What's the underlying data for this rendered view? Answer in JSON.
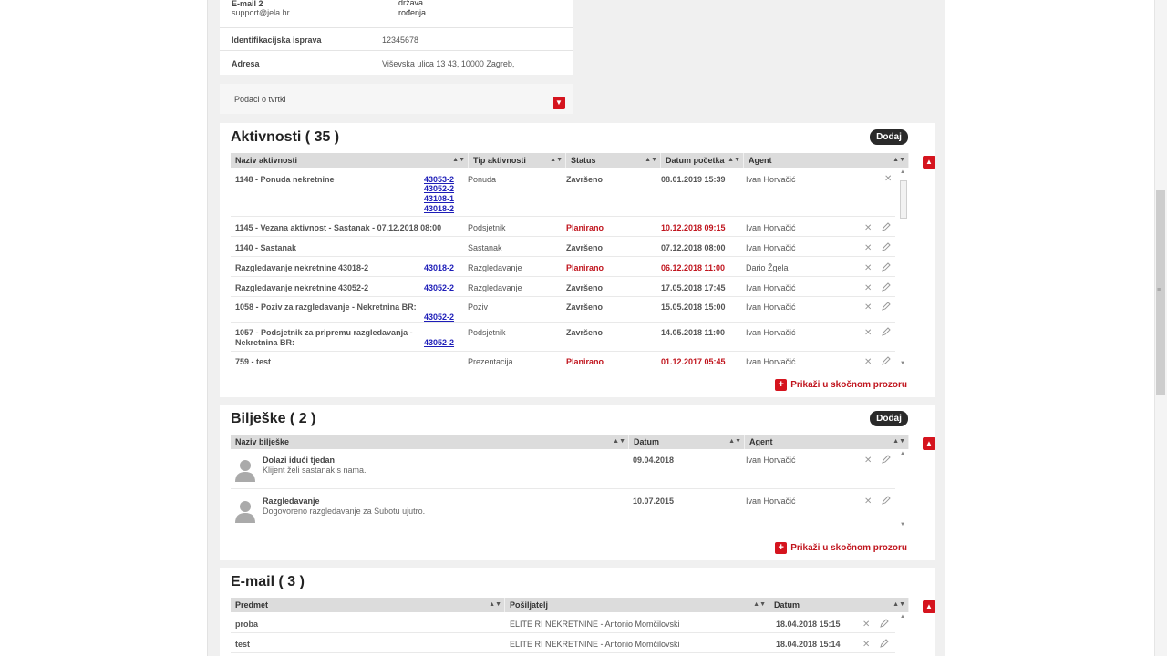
{
  "contact": {
    "email_label": "E-mail 2",
    "email_value": "support@jela.hr",
    "country_label_1": "država",
    "country_label_2": "rođenja",
    "id_label": "Identifikacijska isprava",
    "id_value": "12345678",
    "address_label": "Adresa",
    "address_value": "Viševska ulica 13 43, 10000 Zagreb,",
    "company_label": "Podaci o tvrtki"
  },
  "aktivnosti": {
    "title": "Aktivnosti ( 35 )",
    "add_label": "Dodaj",
    "columns": [
      "Naziv aktivnosti",
      "Tip aktivnosti",
      "Status",
      "Datum početka",
      "Agent"
    ],
    "rows": [
      {
        "name": "1148 - Ponuda nekretnine",
        "name2": "",
        "links": [
          "43053-2",
          "43052-2",
          "43108-1",
          "43018-2"
        ],
        "type": "Ponuda",
        "status": "Završeno",
        "date": "08.01.2019 15:39",
        "agent": "Ivan Horvačić",
        "red": false
      },
      {
        "name": "1145 - Vezana aktivnost - Sastanak - 07.12.2018 08:00",
        "name2": "",
        "links": [],
        "type": "Podsjetnik",
        "status": "Planirano",
        "date": "10.12.2018 09:15",
        "agent": "Ivan Horvačić",
        "red": true
      },
      {
        "name": "1140 - Sastanak",
        "name2": "",
        "links": [],
        "type": "Sastanak",
        "status": "Završeno",
        "date": "07.12.2018 08:00",
        "agent": "Ivan Horvačić",
        "red": false
      },
      {
        "name": "Razgledavanje nekretnine 43018-2",
        "name2": "",
        "links": [
          "43018-2"
        ],
        "type": "Razgledavanje",
        "status": "Planirano",
        "date": "06.12.2018 11:00",
        "agent": "Dario Žgela",
        "red": true
      },
      {
        "name": "Razgledavanje nekretnine 43052-2",
        "name2": "",
        "links": [
          "43052-2"
        ],
        "type": "Razgledavanje",
        "status": "Završeno",
        "date": "17.05.2018 17:45",
        "agent": "Ivan Horvačić",
        "red": false
      },
      {
        "name": "1058 - Poziv za razgledavanje - Nekretnina BR:",
        "name2": "",
        "links": [
          "43052-2"
        ],
        "type": "Poziv",
        "status": "Završeno",
        "date": "15.05.2018 15:00",
        "agent": "Ivan Horvačić",
        "red": false
      },
      {
        "name": "1057 - Podsjetnik za pripremu razgledavanja -",
        "name2": "Nekretnina BR:",
        "links": [
          "43052-2"
        ],
        "type": "Podsjetnik",
        "status": "Završeno",
        "date": "14.05.2018 11:00",
        "agent": "Ivan Horvačić",
        "red": false
      },
      {
        "name": "759 - test",
        "name2": "",
        "links": [],
        "type": "Prezentacija",
        "status": "Planirano",
        "date": "01.12.2017 05:45",
        "agent": "Ivan Horvačić",
        "red": true
      }
    ],
    "popup_label": "Prikaži u skočnom prozoru"
  },
  "biljeske": {
    "title": "Bilješke ( 2 )",
    "add_label": "Dodaj",
    "columns": [
      "Naziv bilješke",
      "Datum",
      "Agent"
    ],
    "rows": [
      {
        "title": "Dolazi idući tjedan",
        "text": "Klijent želi sastanak s nama.",
        "date": "09.04.2018",
        "agent": "Ivan Horvačić"
      },
      {
        "title": "Razgledavanje",
        "text": "Dogovoreno razgledavanje za Subotu ujutro.",
        "date": "10.07.2015",
        "agent": "Ivan Horvačić"
      }
    ],
    "popup_label": "Prikaži u skočnom prozoru"
  },
  "email": {
    "title": "E-mail ( 3 )",
    "columns": [
      "Predmet",
      "Pošiljatelj",
      "Datum"
    ],
    "rows": [
      {
        "subject": "proba",
        "sender": "ELITE RI NEKRETNINE - Antonio Momčilovski",
        "date": "18.04.2018 15:15"
      },
      {
        "subject": "test",
        "sender": "ELITE RI NEKRETNINE - Antonio Momčilovski",
        "date": "18.04.2018 15:14"
      }
    ]
  },
  "colors": {
    "accent_red": "#d5141e",
    "status_red": "#c0141d",
    "link_blue": "#1d1db8"
  }
}
